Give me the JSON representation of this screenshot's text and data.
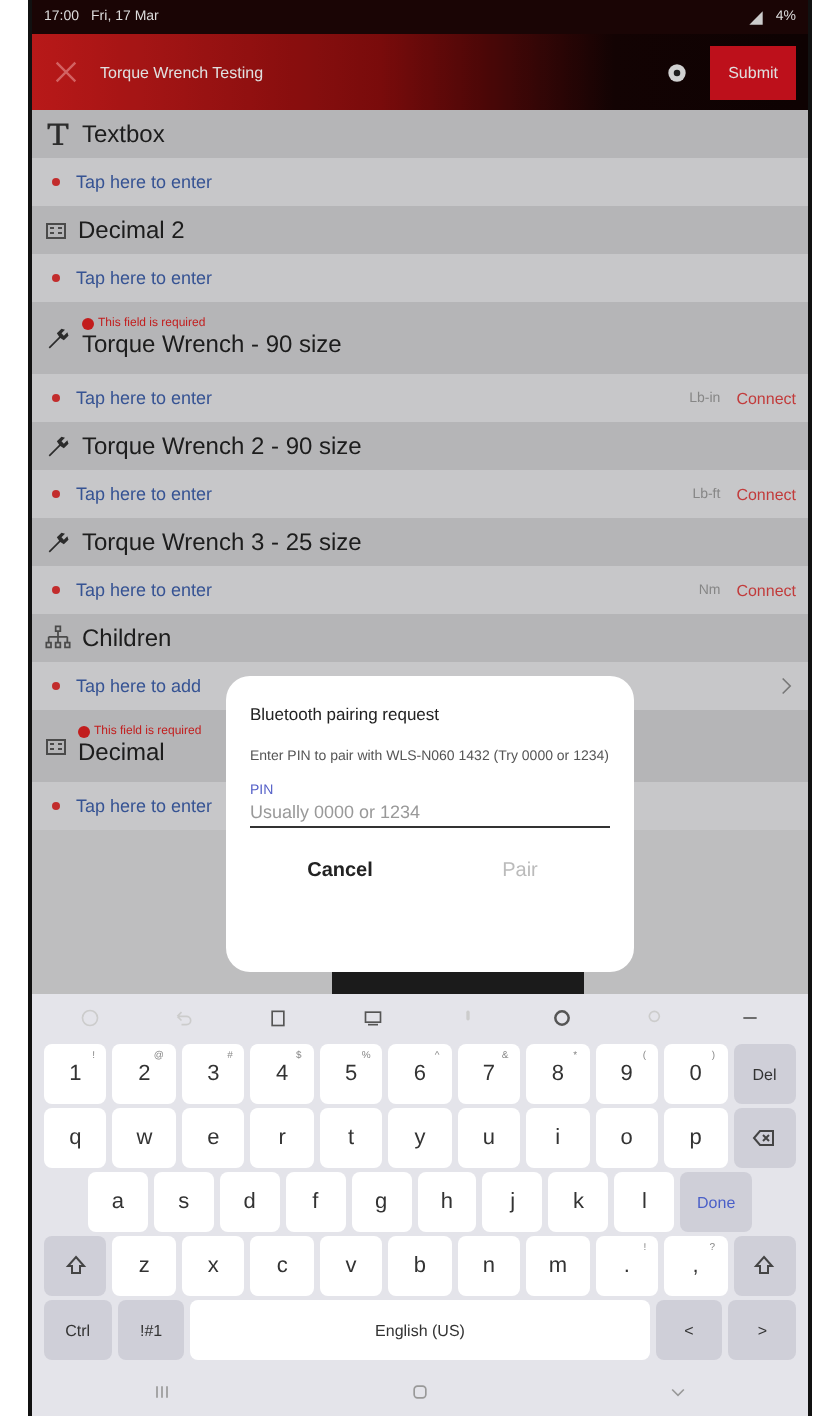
{
  "status_bar": {
    "time": "17:00",
    "date": "Fri, 17 Mar",
    "battery": "4%"
  },
  "header": {
    "title": "Torque Wrench Testing",
    "submit": "Submit"
  },
  "fields": [
    {
      "kind": "text",
      "label": "Textbox",
      "required_error": false,
      "placeholder": "Tap here to enter"
    },
    {
      "kind": "decimal",
      "label": "Decimal 2",
      "required_error": false,
      "placeholder": "Tap here to enter"
    },
    {
      "kind": "torque",
      "label": "Torque Wrench - 90 size",
      "required_error": true,
      "error": "This field is required",
      "placeholder": "Tap here to enter",
      "unit": "Lb-in",
      "action": "Connect"
    },
    {
      "kind": "torque",
      "label": "Torque Wrench 2 - 90 size",
      "required_error": false,
      "placeholder": "Tap here to enter",
      "unit": "Lb-ft",
      "action": "Connect"
    },
    {
      "kind": "torque",
      "label": "Torque Wrench 3 - 25 size",
      "required_error": false,
      "placeholder": "Tap here to enter",
      "unit": "Nm",
      "action": "Connect"
    },
    {
      "kind": "children",
      "label": "Children",
      "required_error": false,
      "placeholder": "Tap here to add"
    },
    {
      "kind": "decimal",
      "label": "Decimal",
      "required_error": true,
      "error": "This field is required",
      "placeholder": "Tap here to enter"
    }
  ],
  "dialog": {
    "title": "Bluetooth pairing request",
    "message": "Enter PIN to pair with WLS-N060 1432 (Try 0000 or 1234)",
    "pin_label": "PIN",
    "pin_placeholder": "Usually 0000 or 1234",
    "buttons": [
      {
        "label": "Cancel",
        "disabled": false
      },
      {
        "label": "Pair",
        "disabled": true
      }
    ]
  },
  "keyboard": {
    "rows": [
      [
        {
          "kind": "char",
          "label": "1",
          "hint": "!"
        },
        {
          "kind": "char",
          "label": "2",
          "hint": "@"
        },
        {
          "kind": "char",
          "label": "3",
          "hint": "#"
        },
        {
          "kind": "char",
          "label": "4",
          "hint": "$"
        },
        {
          "kind": "char",
          "label": "5",
          "hint": "%"
        },
        {
          "kind": "char",
          "label": "6",
          "hint": "^"
        },
        {
          "kind": "char",
          "label": "7",
          "hint": "&"
        },
        {
          "kind": "char",
          "label": "8",
          "hint": "*"
        },
        {
          "kind": "char",
          "label": "9",
          "hint": "("
        },
        {
          "kind": "char",
          "label": "0",
          "hint": ")"
        },
        {
          "kind": "func",
          "label": "Del"
        }
      ],
      [
        {
          "kind": "char",
          "label": "q"
        },
        {
          "kind": "char",
          "label": "w"
        },
        {
          "kind": "char",
          "label": "e"
        },
        {
          "kind": "char",
          "label": "r"
        },
        {
          "kind": "char",
          "label": "t"
        },
        {
          "kind": "char",
          "label": "y"
        },
        {
          "kind": "char",
          "label": "u"
        },
        {
          "kind": "char",
          "label": "i"
        },
        {
          "kind": "char",
          "label": "o"
        },
        {
          "kind": "char",
          "label": "p"
        },
        {
          "kind": "backspace"
        }
      ],
      [
        {
          "kind": "char",
          "label": "a"
        },
        {
          "kind": "char",
          "label": "s"
        },
        {
          "kind": "char",
          "label": "d"
        },
        {
          "kind": "char",
          "label": "f"
        },
        {
          "kind": "char",
          "label": "g"
        },
        {
          "kind": "char",
          "label": "h"
        },
        {
          "kind": "char",
          "label": "j"
        },
        {
          "kind": "char",
          "label": "k"
        },
        {
          "kind": "char",
          "label": "l"
        },
        {
          "kind": "action",
          "label": "Done"
        }
      ],
      [
        {
          "kind": "shift"
        },
        {
          "kind": "char",
          "label": "z"
        },
        {
          "kind": "char",
          "label": "x"
        },
        {
          "kind": "char",
          "label": "c"
        },
        {
          "kind": "char",
          "label": "v"
        },
        {
          "kind": "char",
          "label": "b"
        },
        {
          "kind": "char",
          "label": "n"
        },
        {
          "kind": "char",
          "label": "m"
        },
        {
          "kind": "char",
          "label": ".",
          "hint": "!"
        },
        {
          "kind": "char",
          "label": ",",
          "hint": "?"
        },
        {
          "kind": "shift"
        }
      ]
    ],
    "bottom_bar": [
      {
        "kind": "func",
        "label": "Ctrl"
      },
      {
        "kind": "func",
        "label": "!#1"
      },
      {
        "kind": "space",
        "label": "English (US)"
      },
      {
        "kind": "func",
        "label": "<"
      },
      {
        "kind": "func",
        "label": ">"
      }
    ]
  }
}
